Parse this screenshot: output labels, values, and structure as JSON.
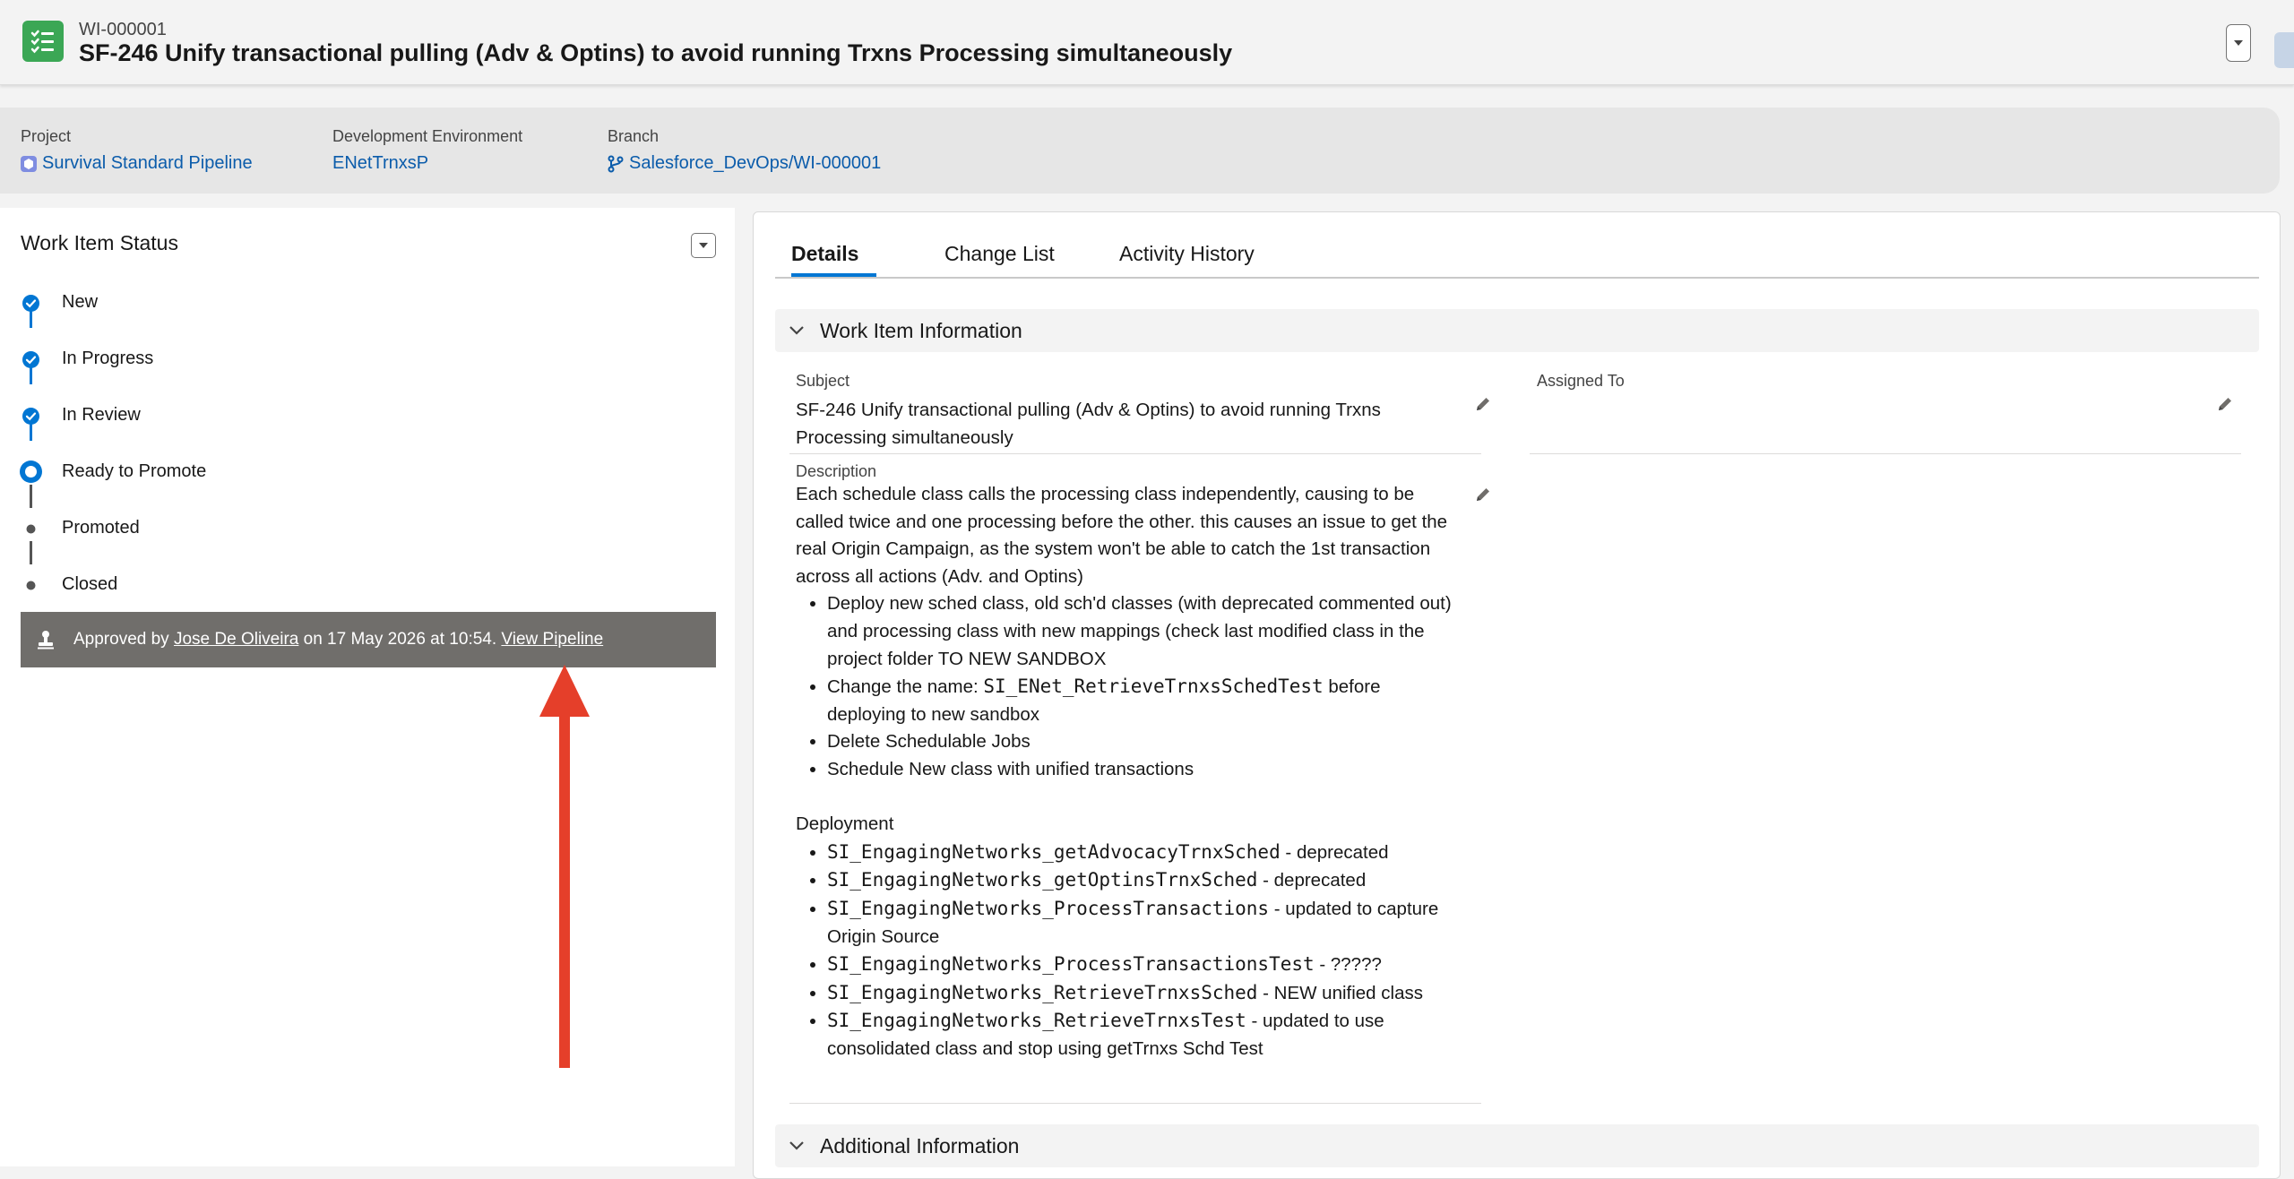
{
  "header": {
    "record_id": "WI-000001",
    "title": "SF-246 Unify transactional pulling (Adv & Optins) to avoid running Trxns Processing simultaneously",
    "icon": "work-item-list-icon",
    "accent_color": "#3ba755"
  },
  "highlights": {
    "project_label": "Project",
    "project_value": "Survival Standard Pipeline",
    "env_label": "Development Environment",
    "env_value": "ENetTrnxsP",
    "branch_label": "Branch",
    "branch_value": "Salesforce_DevOps/WI-000001"
  },
  "status": {
    "title": "Work Item Status",
    "steps": [
      {
        "label": "New",
        "state": "complete"
      },
      {
        "label": "In Progress",
        "state": "complete"
      },
      {
        "label": "In Review",
        "state": "complete"
      },
      {
        "label": "Ready to Promote",
        "state": "current"
      },
      {
        "label": "Promoted",
        "state": "incomplete"
      },
      {
        "label": "Closed",
        "state": "incomplete"
      }
    ],
    "banner": {
      "prefix": "Approved by",
      "approver": "Jose De Oliveira",
      "middle": "on 17 May 2026 at 10:54.",
      "link": "View Pipeline"
    }
  },
  "tabs": [
    "Details",
    "Change List",
    "Activity History"
  ],
  "active_tab": "Details",
  "details": {
    "section_title": "Work Item Information",
    "subject_label": "Subject",
    "subject_line1": "SF-246 Unify transactional pulling (Adv & Optins) to avoid running Trxns",
    "subject_line2": "Processing simultaneously",
    "assigned_label": "Assigned To",
    "assigned_value": "",
    "description_label": "Description",
    "description": {
      "intro": "Each schedule class calls the processing class independently, causing to be called twice and one processing before the other. this causes an issue to get the real Origin Campaign, as the system won't be able to catch the 1st transaction across all actions (Adv. and Optins)",
      "bullet1": "Deploy new sched class, old sch'd classes (with deprecated commented out) and processing class with new mappings (check last modified class in the project folder TO NEW SANDBOX",
      "bullet2_prefix": "Change the name: ",
      "bullet2_code": "SI_ENet_RetrieveTrnxsSchedTest",
      "bullet2_suffix": " before deploying to new sandbox",
      "bullet3": "Delete Schedulable Jobs",
      "bullet4": "Schedule New class with unified transactions",
      "deployment_heading": "Deployment",
      "deployment": [
        {
          "code": "SI_EngagingNetworks_getAdvocacyTrnxSched",
          "text": " - deprecated"
        },
        {
          "code": "SI_EngagingNetworks_getOptinsTrnxSched",
          "text": " - deprecated"
        },
        {
          "code": "SI_EngagingNetworks_ProcessTransactions",
          "text": " - updated to capture Origin Source"
        },
        {
          "code": "SI_EngagingNetworks_ProcessTransactionsTest",
          "text": " - ?????"
        },
        {
          "code": "SI_EngagingNetworks_RetrieveTrnxsSched",
          "text": " - NEW unified class"
        },
        {
          "code": "SI_EngagingNetworks_RetrieveTrnxsTest",
          "text": " - updated to use consolidated class and stop using getTrnxs Schd Test"
        }
      ]
    },
    "additional_title": "Additional Information"
  }
}
